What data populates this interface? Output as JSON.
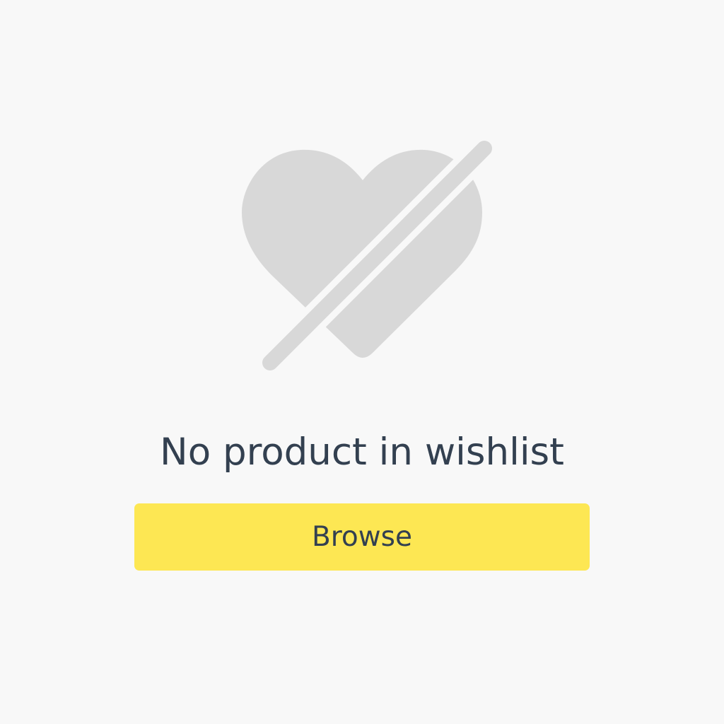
{
  "empty_state": {
    "icon": "heart-off-icon",
    "icon_color": "#d8d8d8",
    "title": "No product in wishlist",
    "browse_button_label": "Browse",
    "button_color": "#fde753",
    "text_color": "#334050",
    "background_color": "#f8f8f8"
  }
}
